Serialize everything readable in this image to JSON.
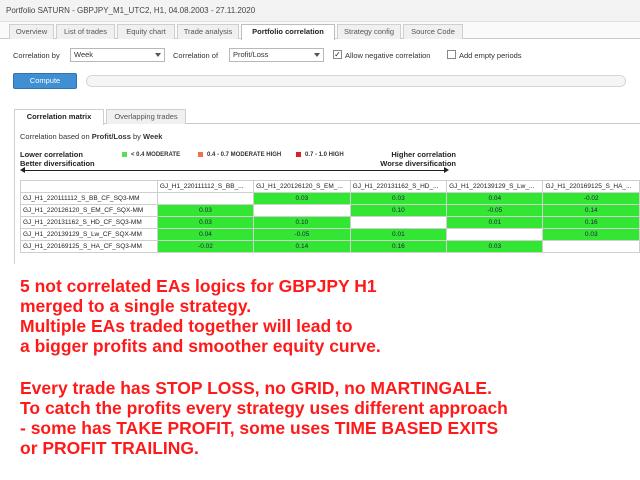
{
  "window": {
    "title": "Portfolio SATURN - GBPJPY_M1_UTC2, H1, 04.08.2003 - 27.11.2020"
  },
  "main_tabs": [
    {
      "label": "Overview"
    },
    {
      "label": "List of trades"
    },
    {
      "label": "Equity chart"
    },
    {
      "label": "Trade analysis"
    },
    {
      "label": "Portfolio correlation"
    },
    {
      "label": "Strategy config"
    },
    {
      "label": "Source Code"
    }
  ],
  "active_main_tab": "Portfolio correlation",
  "controls": {
    "correlation_by_label": "Correlation by",
    "correlation_by_value": "Week",
    "correlation_of_label": "Correlation of",
    "correlation_of_value": "Profit/Loss",
    "allow_negative_label": "Allow negative correlation",
    "allow_negative_checked": "✓",
    "add_empty_label": "Add empty periods",
    "compute_label": "Compute"
  },
  "progress_fraction": 0,
  "sub_tabs": [
    {
      "label": "Correlation matrix"
    },
    {
      "label": "Overlapping trades"
    }
  ],
  "based_on": {
    "prefix": "Correlation based on",
    "metric": "Profit/Loss",
    "by": "by",
    "period": "Week"
  },
  "scale": {
    "left_line1": "Lower correlation",
    "left_line2": "Better diversification",
    "right_line1": "Higher correlation",
    "right_line2": "Worse diversification"
  },
  "legend": [
    {
      "label": "< 0.4 MODERATE",
      "color": "#55e055"
    },
    {
      "label": "0.4 - 0.7 MODERATE HIGH",
      "color": "#f07050"
    },
    {
      "label": "0.7 - 1.0 HIGH",
      "color": "#e02020"
    }
  ],
  "matrix": {
    "columns": [
      "GJ_H1_220111112_S_BB_...",
      "GJ_H1_220126120_S_EM_...",
      "GJ_H1_220131162_S_HD_...",
      "GJ_H1_220139129_S_Lw_...",
      "GJ_H1_220169125_S_HA_..."
    ],
    "rows": [
      {
        "label": "GJ_H1_220111112_S_BB_CF_SQ3-MM",
        "cells": [
          "",
          "0.03",
          "0.03",
          "0.04",
          "-0.02"
        ]
      },
      {
        "label": "GJ_H1_220126120_S_EM_CF_SQX-MM",
        "cells": [
          "0.03",
          "",
          "0.10",
          "-0.05",
          "0.14"
        ]
      },
      {
        "label": "GJ_H1_220131162_S_HD_CF_SQ3-MM",
        "cells": [
          "0.03",
          "0.10",
          "",
          "0.01",
          "0.16"
        ]
      },
      {
        "label": "GJ_H1_220139129_S_Lw_CF_SQX-MM",
        "cells": [
          "0.04",
          "-0.05",
          "0.01",
          "",
          "0.03"
        ]
      },
      {
        "label": "GJ_H1_220169125_S_HA_CF_SQ3-MM",
        "cells": [
          "-0.02",
          "0.14",
          "0.16",
          "0.03",
          ""
        ]
      }
    ],
    "cell_color": "#33e633"
  },
  "overlay_text": {
    "para1": [
      "5 not correlated EAs logics for GBPJPY H1",
      "merged to a single strategy.",
      "Multiple EAs traded together will lead to",
      "a bigger profits and smoother equity curve."
    ],
    "para2": [
      "Every trade has STOP LOSS, no GRID, no MARTINGALE.",
      "To catch the profits every strategy uses different approach",
      "- some has TAKE PROFIT, some uses TIME BASED EXITS",
      "or PROFIT TRAILING."
    ],
    "color": "#ff1a1a"
  }
}
